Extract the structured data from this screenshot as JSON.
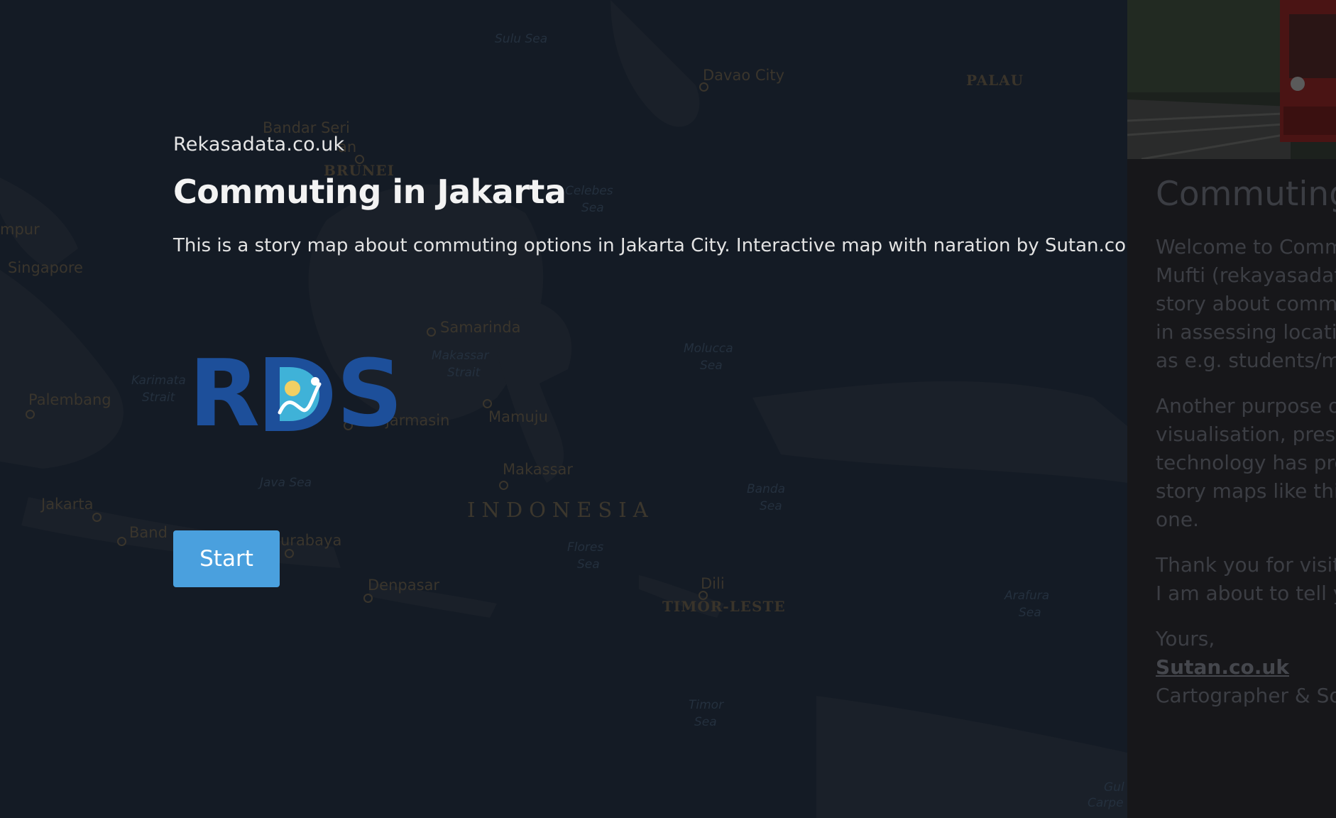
{
  "map": {
    "labels": [
      {
        "text": "Sulu Sea",
        "kind": "sea-inline"
      },
      {
        "text": "Davao City",
        "kind": "city"
      },
      {
        "text": "PALAU",
        "kind": "country"
      },
      {
        "text": "Bandar Seri",
        "kind": "city"
      },
      {
        "text": "an",
        "kind": "city"
      },
      {
        "text": "BRUNEI",
        "kind": "country"
      },
      {
        "text": "Celebes",
        "kind": "sea"
      },
      {
        "text": "Sea",
        "kind": "sea"
      },
      {
        "text": "mpur",
        "kind": "city"
      },
      {
        "text": "Singapore",
        "kind": "city"
      },
      {
        "text": "Samarinda",
        "kind": "city"
      },
      {
        "text": "Makassar",
        "kind": "sea"
      },
      {
        "text": "Strait",
        "kind": "sea"
      },
      {
        "text": "Molucca",
        "kind": "sea"
      },
      {
        "text": "Sea",
        "kind": "sea"
      },
      {
        "text": "Palembang",
        "kind": "city"
      },
      {
        "text": "Karimata",
        "kind": "sea"
      },
      {
        "text": "Strait",
        "kind": "sea"
      },
      {
        "text": "jarmasin",
        "kind": "city"
      },
      {
        "text": "Mamuju",
        "kind": "city"
      },
      {
        "text": "Makassar",
        "kind": "city"
      },
      {
        "text": "Java Sea",
        "kind": "sea"
      },
      {
        "text": "Banda",
        "kind": "sea"
      },
      {
        "text": "Sea",
        "kind": "sea"
      },
      {
        "text": "Jakarta",
        "kind": "city"
      },
      {
        "text": "INDONESIA",
        "kind": "big"
      },
      {
        "text": "Band",
        "kind": "city"
      },
      {
        "text": "urabaya",
        "kind": "city"
      },
      {
        "text": "Flores",
        "kind": "sea"
      },
      {
        "text": "Sea",
        "kind": "sea"
      },
      {
        "text": "Dili",
        "kind": "city"
      },
      {
        "text": "Denpasar",
        "kind": "city"
      },
      {
        "text": "TIMOR-LESTE",
        "kind": "country"
      },
      {
        "text": "Arafura",
        "kind": "sea"
      },
      {
        "text": "Sea",
        "kind": "sea"
      },
      {
        "text": "Timor",
        "kind": "sea"
      },
      {
        "text": "Sea",
        "kind": "sea"
      },
      {
        "text": "Gul",
        "kind": "sea"
      },
      {
        "text": "Carpe",
        "kind": "sea"
      }
    ]
  },
  "intro": {
    "site": "Rekasadata.co.uk",
    "title": "Commuting in Jakarta",
    "description": "This is a story map about commuting options in Jakarta City. Interactive map with naration by Sutan.co.uk.",
    "logo_text": "RDS",
    "start_label": "Start"
  },
  "panel": {
    "title": "Commuting",
    "p1": [
      "Welcome to Commu",
      "Mufti (rekayasadata",
      "story about commut",
      "in assessing locatio",
      "as e.g. students/mig"
    ],
    "p2": [
      "Another purpose of",
      "visualisation, preser",
      "technology has prog",
      "story maps like this",
      "one."
    ],
    "p3": [
      "Thank you for visitin",
      "I am about to tell yo"
    ],
    "closing": "Yours,",
    "link": "Sutan.co.uk",
    "role": "Cartographer & Sof"
  },
  "colors": {
    "background": "#141b25",
    "accent": "#4aa0de",
    "logo_blue": "#1d4f9a",
    "logo_teal": "#3fb2d8",
    "logo_sun": "#f2cf63"
  }
}
